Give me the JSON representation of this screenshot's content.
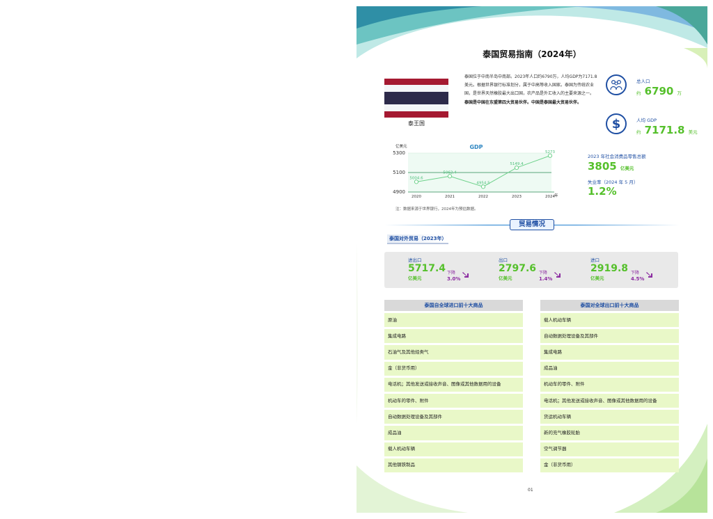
{
  "title": "泰国贸易指南（2024年）",
  "flag": {
    "colors": [
      "#a51931",
      "#f4f5f8",
      "#2d2a4a",
      "#2d2a4a",
      "#f4f5f8",
      "#a51931"
    ]
  },
  "country": "泰王国",
  "intro": {
    "p1": "泰国位于中南半岛中南部。2023年人口约6790万，人均GDP为7171.8美元。根据世界银行标准划分，属于中高等收入国家。泰国为传统农业国，是世界天然橡胶最大出口国，农产品是外汇收入的主要来源之一。",
    "p2": "泰国是中国在东盟第四大贸易伙伴。中国是泰国最大贸易伙伴。"
  },
  "stats": {
    "population": {
      "icon": "people-icon",
      "label": "总人口",
      "prefix": "约",
      "value": "6790",
      "unit": "万"
    },
    "gdp_per_capita": {
      "icon": "dollar-icon",
      "label": "人均 GDP",
      "prefix": "约",
      "value": "7171.8",
      "unit": "美元"
    }
  },
  "right_stats": {
    "retail_label": "2023 年社会消费品零售总额",
    "retail_value": "3805",
    "retail_unit": "亿美元",
    "unemp_label": "失业率（2024 年 5 月）",
    "unemp_value": "1.2%"
  },
  "chart_data": {
    "type": "line",
    "title": "GDP",
    "ylabel": "亿美元",
    "xlabel": "年",
    "x": [
      "2020",
      "2021",
      "2022",
      "2023",
      "2024"
    ],
    "values": [
      5004.6,
      5062.4,
      4954.5,
      5149.4,
      5273
    ],
    "data_labels": [
      "5004.6",
      "5062.4",
      "4954.5",
      "5149.4",
      "5273"
    ],
    "yticks": [
      "5300",
      "5100",
      "4900"
    ],
    "ylim": [
      4900,
      5300
    ],
    "reference_line": 5100,
    "colors": {
      "line": "#6dd18a",
      "axis": "#2e8b57"
    }
  },
  "note": "注：数据来源于世界银行，2024年为预估数据。",
  "trade_heading": "贸易情况",
  "trade_sub": "泰国对外贸易（2023年）",
  "trade": [
    {
      "label": "进出口",
      "value": "5717.4",
      "unit": "亿美元",
      "dir": "下降",
      "pct": "3.0%"
    },
    {
      "label": "出口",
      "value": "2797.6",
      "unit": "亿美元",
      "dir": "下降",
      "pct": "1.4%"
    },
    {
      "label": "进口",
      "value": "2919.8",
      "unit": "亿美元",
      "dir": "下降",
      "pct": "4.5%"
    }
  ],
  "imports": {
    "header": "泰国自全球进口前十大商品",
    "items": [
      "原油",
      "集成电路",
      "石油气及其他烃类气",
      "金（非货币用）",
      "电话机；其他发送或接收声音、图像或其他数据用的设备",
      "机动车的零件、附件",
      "自动数据处理设备及其部件",
      "成品油",
      "载人机动车辆",
      "其他钢铁制品"
    ]
  },
  "exports": {
    "header": "泰国对全球出口前十大商品",
    "items": [
      "载人机动车辆",
      "自动数据处理设备及其部件",
      "集成电路",
      "成品油",
      "机动车的零件、附件",
      "电话机；其他发送或接收声音、图像或其他数据用的设备",
      "货运机动车辆",
      "新的充气橡胶轮胎",
      "空气调节器",
      "金（非货币用）"
    ]
  },
  "page_number": "01"
}
